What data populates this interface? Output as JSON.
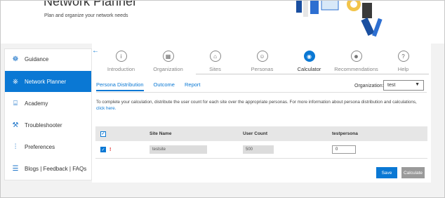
{
  "header": {
    "title": "Network Planner",
    "subtitle": "Plan and organize your network needs"
  },
  "sidebar": {
    "items": [
      {
        "label": "Guidance",
        "icon": "guidance-icon",
        "active": false
      },
      {
        "label": "Network Planner",
        "icon": "network-planner-icon",
        "active": true
      },
      {
        "label": "Academy",
        "icon": "academy-icon",
        "active": false
      },
      {
        "label": "Troubleshooter",
        "icon": "troubleshooter-icon",
        "active": false
      },
      {
        "label": "Preferences",
        "icon": "preferences-icon",
        "active": false
      },
      {
        "label": "Blogs | Feedback | FAQs",
        "icon": "blogs-icon",
        "active": false
      }
    ]
  },
  "steps": [
    {
      "label": "Introduction",
      "icon": "info-icon",
      "glyph": "i"
    },
    {
      "label": "Organization",
      "icon": "organization-icon",
      "glyph": "▦"
    },
    {
      "label": "Sites",
      "icon": "sites-icon",
      "glyph": "⌂"
    },
    {
      "label": "Personas",
      "icon": "personas-icon",
      "glyph": "☺"
    },
    {
      "label": "Calculator",
      "icon": "calculator-icon",
      "glyph": "◉"
    },
    {
      "label": "Recommendations",
      "icon": "recommendations-icon",
      "glyph": "☻"
    },
    {
      "label": "Help",
      "icon": "help-icon",
      "glyph": "?"
    }
  ],
  "active_step": "Calculator",
  "subtabs": [
    "Persona Distribution",
    "Outcome",
    "Report"
  ],
  "organization": {
    "label": "Organization:",
    "value": "test"
  },
  "info": {
    "text": "To complete your calculation, distribute the user count for each site over the appropriate personas. For more information about persona distribution and calculations, ",
    "link": "click here."
  },
  "table": {
    "headers": [
      "",
      "Site Name",
      "User Count",
      "testpersona"
    ],
    "rows": [
      {
        "site": "testsite",
        "users": "500",
        "persona_value": "0"
      }
    ]
  },
  "buttons": {
    "save": "Save",
    "calculate": "Calculate"
  },
  "colors": {
    "accent": "#0a78d4",
    "warning": "#dd2222"
  }
}
